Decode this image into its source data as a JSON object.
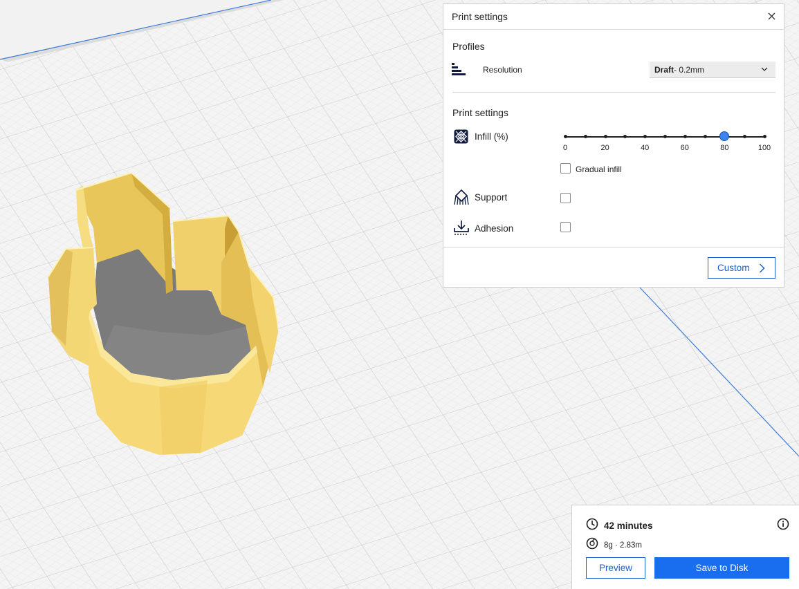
{
  "print_settings": {
    "title": "Print settings",
    "profiles": {
      "heading": "Profiles",
      "resolution_label": "Resolution",
      "resolution_bold": "Draft",
      "resolution_rest": " - 0.2mm"
    },
    "settings": {
      "heading": "Print settings",
      "infill_label": "Infill (%)",
      "infill_value": 80,
      "infill_ticks": [
        "0",
        "20",
        "40",
        "60",
        "80",
        "100"
      ],
      "gradual_infill_label": "Gradual infill",
      "gradual_infill_checked": false,
      "support_label": "Support",
      "support_checked": false,
      "adhesion_label": "Adhesion",
      "adhesion_checked": false
    },
    "custom_button": "Custom"
  },
  "estimate": {
    "time": "42 minutes",
    "material": "8g · 2.83m",
    "preview_button": "Preview",
    "save_button": "Save to Disk"
  },
  "colors": {
    "accent": "#196ef0",
    "model": "#f5d66b",
    "build_plate": "#f2f2f2"
  },
  "icons": {
    "resolution": "layers-icon",
    "infill": "infill-icon",
    "support": "support-icon",
    "adhesion": "adhesion-icon",
    "time": "clock-icon",
    "material": "spool-icon",
    "info": "info-icon"
  }
}
